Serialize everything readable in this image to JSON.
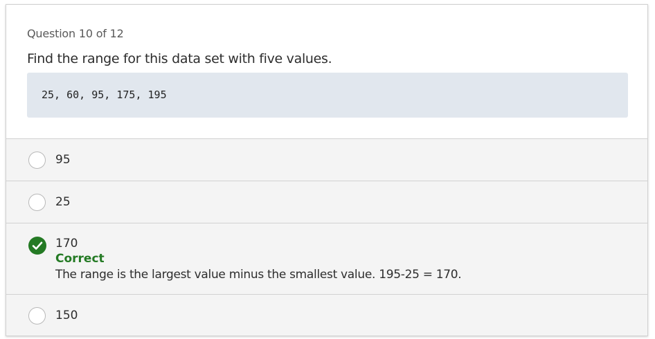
{
  "question": {
    "progress": "Question 10 of 12",
    "prompt": "Find the range for this data set with five values.",
    "dataset": "25, 60, 95, 175, 195"
  },
  "options": [
    {
      "label": "95",
      "selected": false
    },
    {
      "label": "25",
      "selected": false
    },
    {
      "label": "170",
      "selected": true,
      "feedback_title": "Correct",
      "feedback_text": "The range is the largest value minus the smallest value. 195-25 = 170."
    },
    {
      "label": "150",
      "selected": false
    }
  ],
  "colors": {
    "correct": "#247a24",
    "dataset_bg": "#e1e7ee",
    "option_bg": "#f4f4f4",
    "border": "#d1d1d1"
  },
  "icons": {
    "selected": "checkmark-circle-icon",
    "unselected": "radio-circle-icon"
  }
}
